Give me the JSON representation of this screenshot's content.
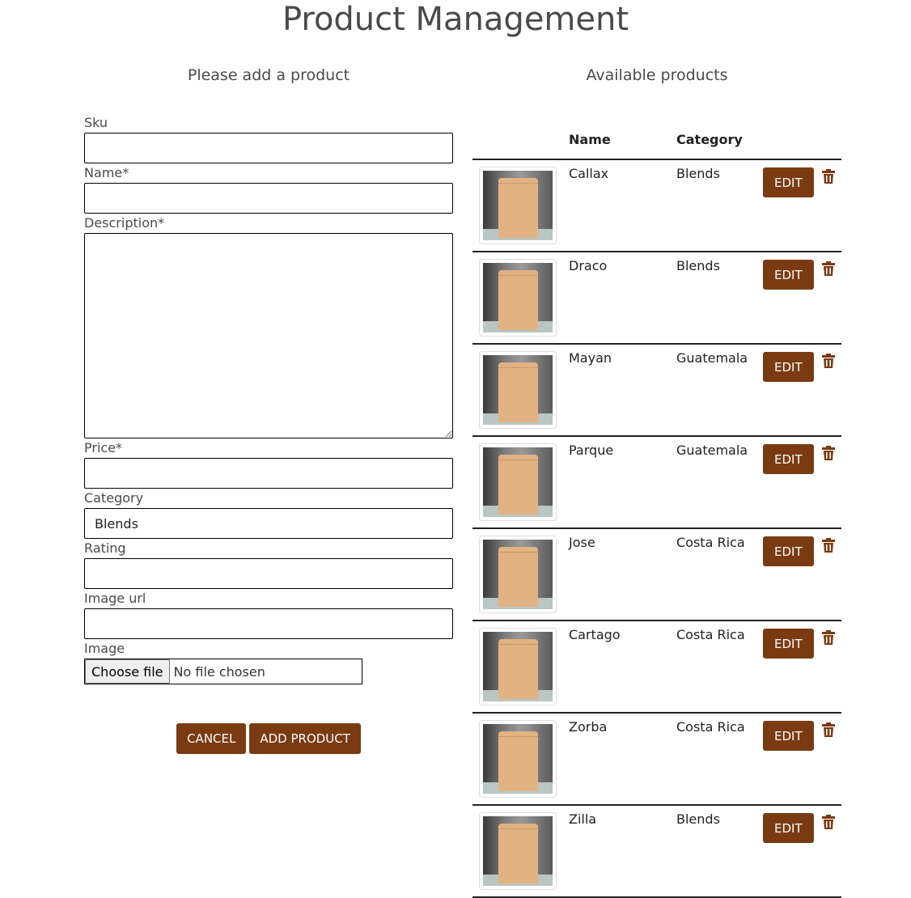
{
  "header": {
    "title": "Product Management"
  },
  "form": {
    "heading": "Please add a product",
    "fields": {
      "sku": {
        "label": "Sku",
        "value": ""
      },
      "name": {
        "label": "Name*",
        "value": ""
      },
      "description": {
        "label": "Description*",
        "value": ""
      },
      "price": {
        "label": "Price*",
        "value": ""
      },
      "category": {
        "label": "Category",
        "value": "Blends"
      },
      "rating": {
        "label": "Rating",
        "value": ""
      },
      "image_url": {
        "label": "Image url",
        "value": ""
      },
      "image": {
        "label": "Image",
        "button": "Choose file",
        "status": "No file chosen"
      }
    },
    "buttons": {
      "cancel": "CANCEL",
      "add": "ADD PRODUCT"
    }
  },
  "products": {
    "heading": "Available products",
    "columns": {
      "name": "Name",
      "category": "Category"
    },
    "edit_label": "EDIT",
    "rows": [
      {
        "name": "Callax",
        "category": "Blends"
      },
      {
        "name": "Draco",
        "category": "Blends"
      },
      {
        "name": "Mayan",
        "category": "Guatemala"
      },
      {
        "name": "Parque",
        "category": "Guatemala"
      },
      {
        "name": "Jose",
        "category": "Costa Rica"
      },
      {
        "name": "Cartago",
        "category": "Costa Rica"
      },
      {
        "name": "Zorba",
        "category": "Costa Rica"
      },
      {
        "name": "Zilla",
        "category": "Blends"
      }
    ]
  },
  "colors": {
    "accent": "#7a3b12",
    "text": "#222222",
    "heading": "#4a4a4a"
  },
  "icons": {
    "delete": "trash-icon",
    "product": "coffee-bag-image"
  }
}
